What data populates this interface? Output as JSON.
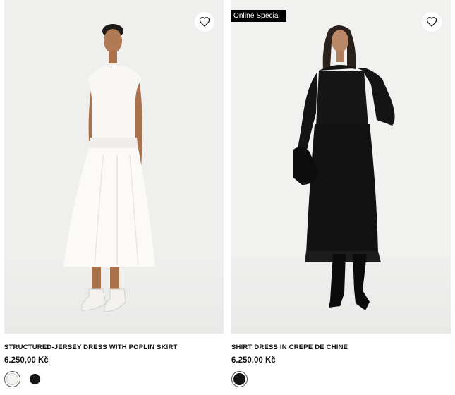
{
  "products": [
    {
      "name": "STRUCTURED-JERSEY DRESS WITH POPLIN SKIRT",
      "price": "6.250,00 Kč",
      "badge": "",
      "favorite_icon": "heart-outline-icon",
      "colors": [
        {
          "name": "white",
          "hex": "#f4f3f0",
          "selected": true
        },
        {
          "name": "black",
          "hex": "#151515",
          "selected": false
        }
      ]
    },
    {
      "name": "SHIRT DRESS IN CREPE DE CHINE",
      "price": "6.250,00 Kč",
      "badge": "Online Special",
      "favorite_icon": "heart-outline-icon",
      "colors": [
        {
          "name": "black",
          "hex": "#151515",
          "selected": true
        }
      ]
    }
  ]
}
